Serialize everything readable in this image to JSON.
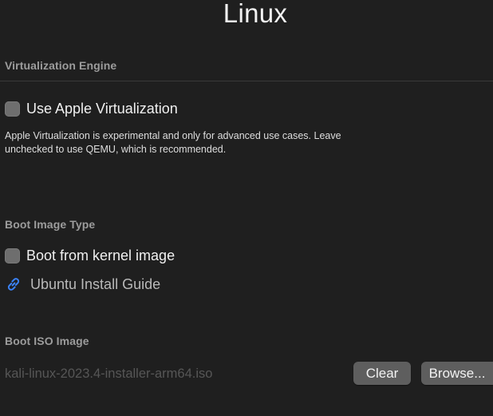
{
  "window": {
    "title": "Linux"
  },
  "virtualization": {
    "section_label": "Virtualization Engine",
    "checkbox_label": "Use Apple Virtualization",
    "checked": false,
    "description_line1": "Apple Virtualization is experimental and only for advanced use cases. Leave",
    "description_line2": "unchecked to use QEMU, which is recommended."
  },
  "boot_type": {
    "section_label": "Boot Image Type",
    "checkbox_label": "Boot from kernel image",
    "checked": false,
    "guide_link_label": "Ubuntu Install Guide",
    "guide_icon": "link-icon"
  },
  "boot_iso": {
    "section_label": "Boot ISO Image",
    "path_value": "kali-linux-2023.4-installer-arm64.iso",
    "clear_label": "Clear",
    "browse_label": "Browse..."
  },
  "colors": {
    "background": "#1f1f1f",
    "checkbox": "#6e6e6e",
    "link_icon": "#3b82f6",
    "button": "#5e5e5e",
    "section_label": "#9c9c9c"
  }
}
